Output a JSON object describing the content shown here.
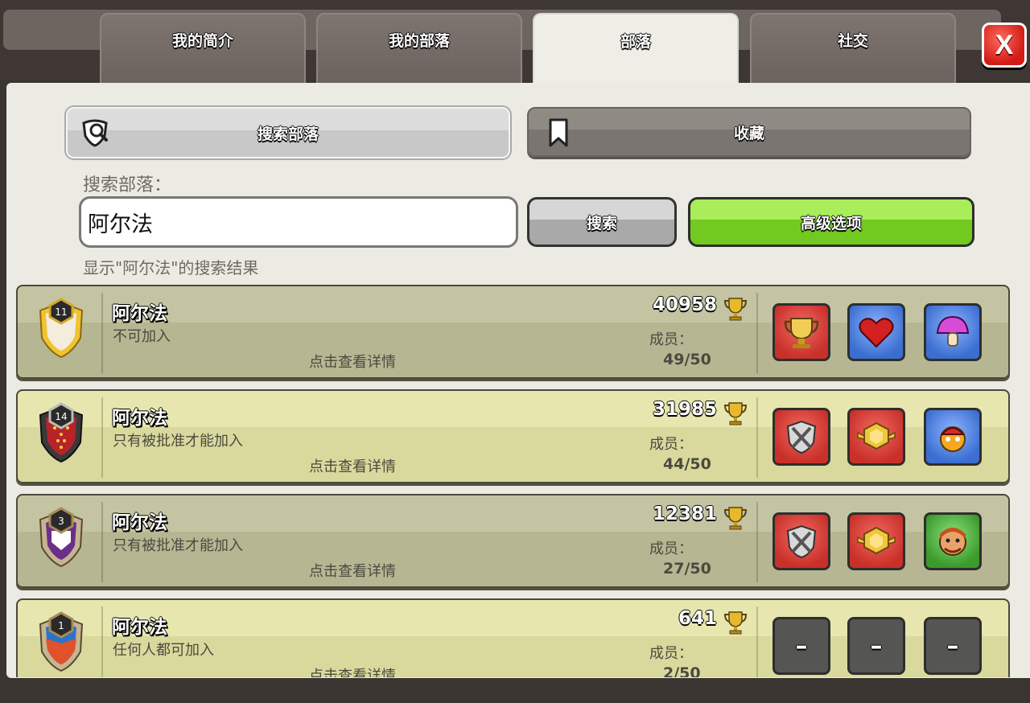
{
  "tabs": [
    {
      "label": "我的简介"
    },
    {
      "label": "我的部落"
    },
    {
      "label": "部落"
    },
    {
      "label": "社交"
    }
  ],
  "close_label": "X",
  "segments": {
    "search_label": "搜索部落",
    "favorites_label": "收藏"
  },
  "search": {
    "field_label": "搜索部落：",
    "value": "阿尔法",
    "button_label": "搜索",
    "advanced_label": "高级选项",
    "result_caption": "显示\"阿尔法\"的搜索结果"
  },
  "results": [
    {
      "level": "11",
      "name": "阿尔法",
      "type": "不可加入",
      "detail": "点击查看详情",
      "trophies": "40958",
      "members_label": "成员：",
      "members": "49/50",
      "tiles": [
        "trophy-icon",
        "heart-icon",
        "mushroom-icon"
      ]
    },
    {
      "level": "14",
      "name": "阿尔法",
      "type": "只有被批准才能加入",
      "detail": "点击查看详情",
      "trophies": "31985",
      "members_label": "成员：",
      "members": "44/50",
      "tiles": [
        "crossed-swords-icon",
        "league-emblem-icon",
        "balloon-icon"
      ]
    },
    {
      "level": "3",
      "name": "阿尔法",
      "type": "只有被批准才能加入",
      "detail": "点击查看详情",
      "trophies": "12381",
      "members_label": "成员：",
      "members": "27/50",
      "tiles": [
        "crossed-swords-icon",
        "league-emblem-icon",
        "barbarian-face-icon"
      ]
    },
    {
      "level": "1",
      "name": "阿尔法",
      "type": "任何人都可加入",
      "detail": "点击查看详情",
      "trophies": "641",
      "members_label": "成员：",
      "members": "2/50",
      "tiles": [
        "empty-label-icon",
        "empty-label-icon",
        "empty-label-icon"
      ],
      "empty_label": "–"
    }
  ],
  "colors": {
    "active_tab": "#eeeee6",
    "advanced_button": "#72c91f",
    "close_button": "#d11b14"
  }
}
